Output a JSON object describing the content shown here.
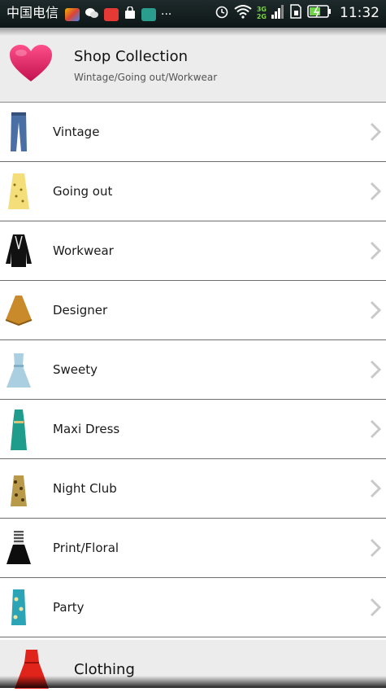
{
  "status_bar": {
    "carrier": "中国电信",
    "time": "11:32",
    "network_labels": [
      "3G",
      "2G"
    ],
    "dots": "···"
  },
  "header": {
    "title": "Shop Collection",
    "subtitle": "Wintage/Going out/Workwear",
    "icon": "heart-icon",
    "accent_color": "#d81b5b"
  },
  "categories": [
    {
      "label": "Vintage",
      "icon": "jeans-icon"
    },
    {
      "label": "Going out",
      "icon": "yellow-dress-icon"
    },
    {
      "label": "Workwear",
      "icon": "black-jacket-icon"
    },
    {
      "label": "Designer",
      "icon": "poncho-icon"
    },
    {
      "label": "Sweety",
      "icon": "blue-dress-icon"
    },
    {
      "label": "Maxi Dress",
      "icon": "maxi-dress-icon"
    },
    {
      "label": "Night Club",
      "icon": "leopard-dress-icon"
    },
    {
      "label": "Print/Floral",
      "icon": "print-dress-icon"
    },
    {
      "label": "Party",
      "icon": "party-dress-icon"
    }
  ],
  "footer": {
    "label": "Clothing",
    "icon": "red-dress-icon"
  }
}
